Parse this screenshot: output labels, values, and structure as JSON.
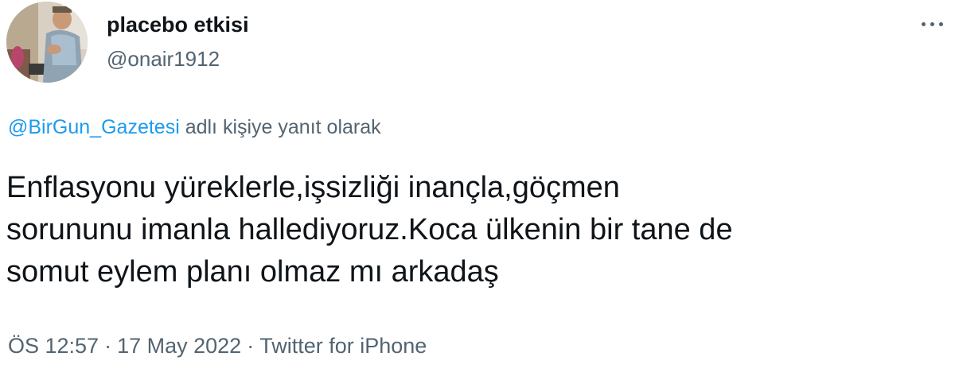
{
  "author": {
    "display_name": "placebo etkisi",
    "handle": "@onair1912"
  },
  "menu": {
    "icon": "more-horizontal-icon"
  },
  "reply_context": {
    "mention": "@BirGun_Gazetesi",
    "suffix": " adlı kişiye yanıt olarak"
  },
  "tweet": {
    "text": "Enflasyonu yüreklerle,işsizliği inançla,göçmen\nsorununu imanla hallediyoruz.Koca ülkenin bir tane de\nsomut eylem planı olmaz mı arkadaş"
  },
  "meta": {
    "time": "ÖS 12:57",
    "separator": "·",
    "date": "17 May 2022",
    "source": "Twitter for iPhone"
  },
  "colors": {
    "text_primary": "#0f1419",
    "text_secondary": "#536471",
    "link": "#1d9bf0"
  }
}
